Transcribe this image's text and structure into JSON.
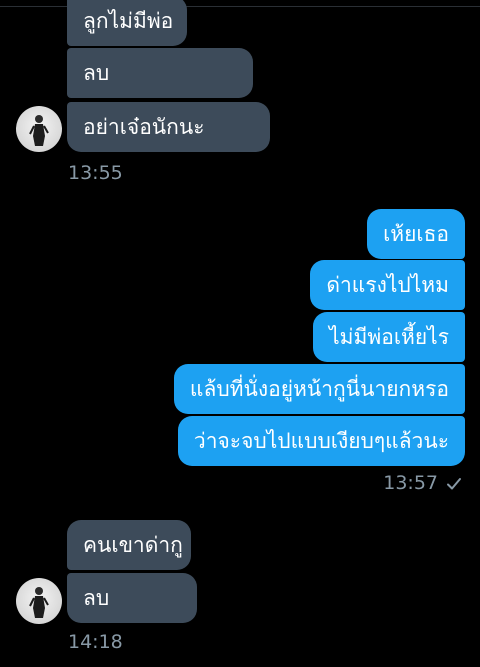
{
  "conversation": {
    "incoming_group_1": [
      "ลูกไม่มีพ่อ",
      "ลบ",
      "อย่าเจ๋อนักนะ"
    ],
    "incoming_group_1_time": "13:55",
    "outgoing_group": [
      "เห้ยเธอ",
      "ด่าแรงไปไหม",
      "ไม่มีพ่อเหี้ยไร",
      "แล้บที่นั่งอยู่หน้ากูนี่นายกหรอ",
      "ว่าจะจบไปแบบเงียบๆแล้วนะ"
    ],
    "outgoing_group_time": "13:57",
    "incoming_group_2": [
      "คนเขาด่ากู",
      "ลบ"
    ],
    "incoming_group_2_time": "14:18"
  },
  "icons": {
    "read_receipt": "checkmark-icon",
    "avatar": "contact-avatar"
  },
  "colors": {
    "background": "#000000",
    "incoming_bubble": "#3d4b5a",
    "outgoing_bubble": "#1da1f2",
    "timestamp": "#8899a6"
  }
}
